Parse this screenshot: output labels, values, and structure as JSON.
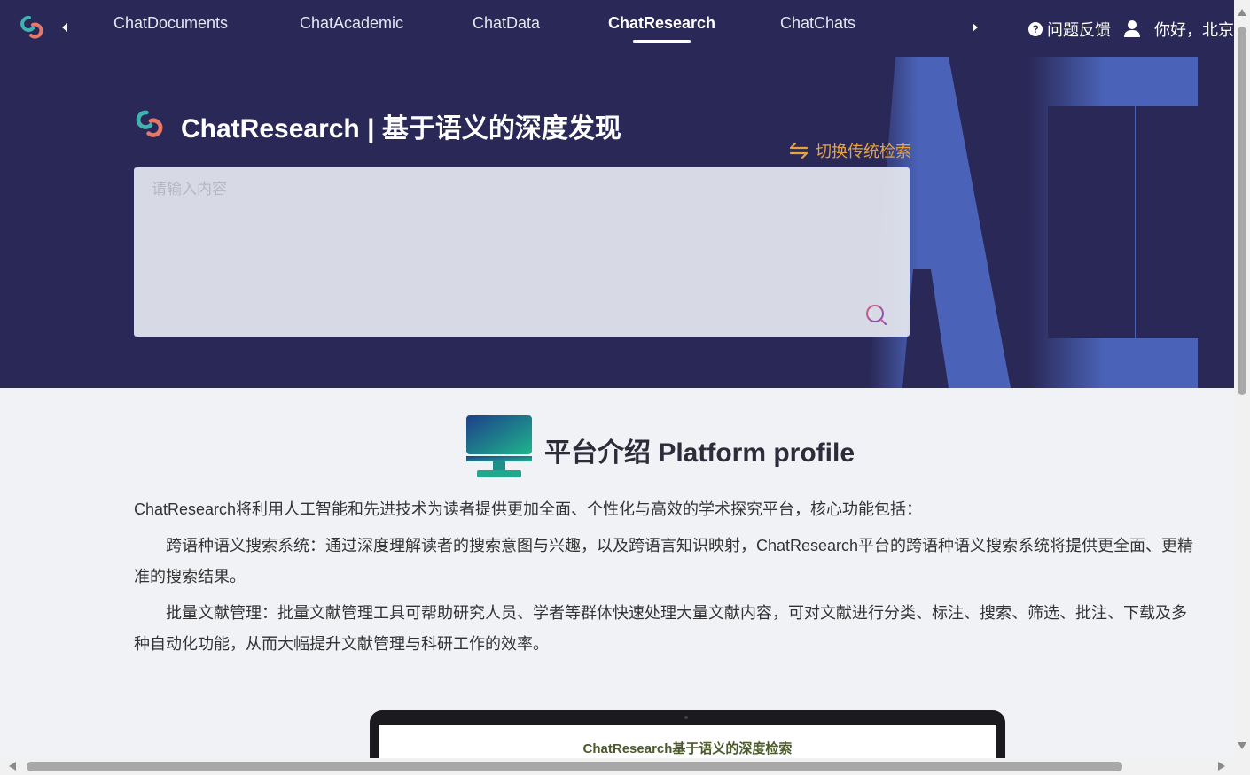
{
  "nav": {
    "tabs": [
      {
        "label": "ChatDocuments"
      },
      {
        "label": "ChatAcademic"
      },
      {
        "label": "ChatData"
      },
      {
        "label": "ChatResearch",
        "active": true
      },
      {
        "label": "ChatChats"
      }
    ],
    "feedback_label": "问题反馈",
    "greeting": "你好，北京"
  },
  "hero": {
    "title": "ChatResearch | 基于语义的深度发现",
    "switch_label": "切换传统检索",
    "search_placeholder": "请输入内容",
    "background_text": "AI"
  },
  "intro": {
    "title": "平台介绍 Platform profile",
    "lead": "ChatResearch将利用人工智能和先进技术为读者提供更加全面、个性化与高效的学术探究平台，核心功能包括：",
    "para1": "跨语种语义搜索系统：通过深度理解读者的搜索意图与兴趣，以及跨语言知识映射，ChatResearch平台的跨语种语义搜索系统将提供更全面、更精准的搜索结果。",
    "para2": "批量文献管理：批量文献管理工具可帮助研究人员、学者等群体快速处理大量文献内容，可对文献进行分类、标注、搜索、筛选、批注、下载及多种自动化功能，从而大幅提升文献管理与科研工作的效率。"
  },
  "preview": {
    "title": "ChatResearch基于语义的深度检索"
  },
  "colors": {
    "nav_bg": "#2a2856",
    "accent_orange": "#e8a23f",
    "ai_blue": "#4a63b8"
  },
  "icons": {
    "logo": "infinity-logo-icon",
    "search": "search-icon",
    "switch": "switch-arrows-icon",
    "help": "help-circle-icon",
    "user": "user-icon",
    "monitor": "monitor-icon"
  }
}
